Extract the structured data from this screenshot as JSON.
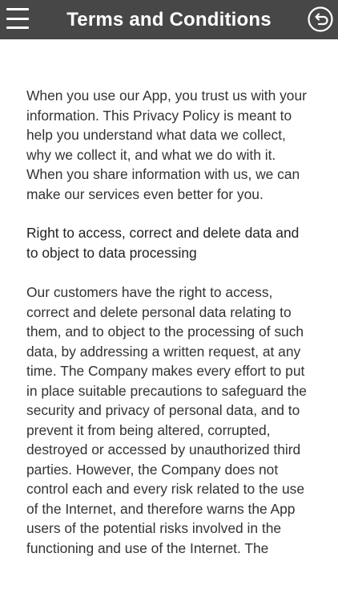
{
  "header": {
    "title": "Terms and Conditions",
    "menu_icon": "hamburger-menu-icon",
    "back_icon": "back-arrow-circle-icon",
    "background": "#474747",
    "text_color": "#ffffff"
  },
  "content": {
    "intro": "When you use our App, you trust us with your information. This Privacy Policy is meant to help you understand what data we collect, why we collect it, and what we do with it. When you share information with us, we can make our services even better for you.",
    "section_heading": "Right to access, correct and delete data and to object to data processing",
    "section_body": "Our customers have the right to access, correct and delete personal data relating to them, and to object to the processing of such data, by addressing a written request, at any time. The Company makes every effort to put in place suitable precautions to safeguard the security and privacy of personal data, and to prevent it from being altered, corrupted, destroyed or accessed by unauthorized third parties. However, the Company does not control each and every risk related to the use of the Internet, and therefore warns the App users of the potential risks involved in the functioning and use of the Internet. The"
  }
}
